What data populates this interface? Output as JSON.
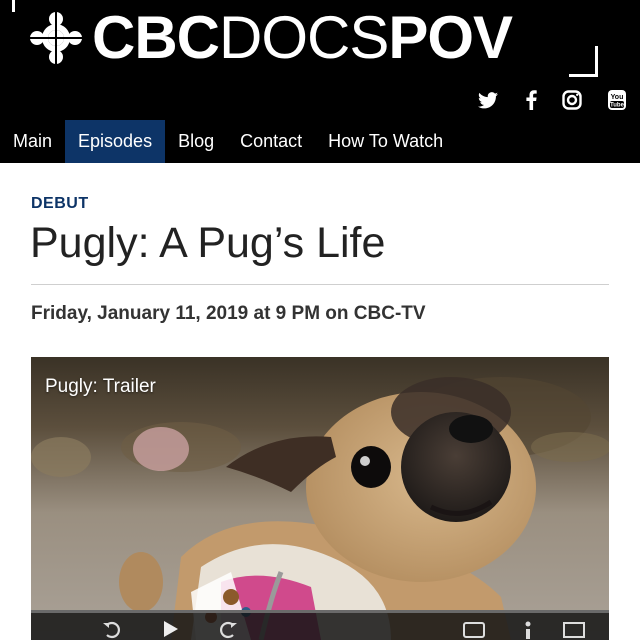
{
  "header": {
    "brand": {
      "part1": "CBC",
      "part2": "DOCS",
      "part3": "POV"
    },
    "social": [
      "twitter-icon",
      "facebook-icon",
      "instagram-icon",
      "youtube-icon"
    ],
    "colors": {
      "background": "#000000",
      "text": "#ffffff"
    }
  },
  "nav": {
    "items": [
      {
        "label": "Main"
      },
      {
        "label": "Episodes"
      },
      {
        "label": "Blog"
      },
      {
        "label": "Contact"
      },
      {
        "label": "How To Watch"
      }
    ],
    "active_index": 1,
    "active_color": "#0d3467"
  },
  "article": {
    "kicker": "DEBUT",
    "title": "Pugly: A Pug’s Life",
    "airdate": "Friday, January 11, 2019 at 9 PM on CBC-TV",
    "kicker_color": "#0d3467"
  },
  "video": {
    "title": "Pugly: Trailer",
    "controls": [
      "replay-icon",
      "play-icon",
      "forward-icon",
      "captions-icon",
      "more-icon",
      "fullscreen-icon"
    ]
  }
}
